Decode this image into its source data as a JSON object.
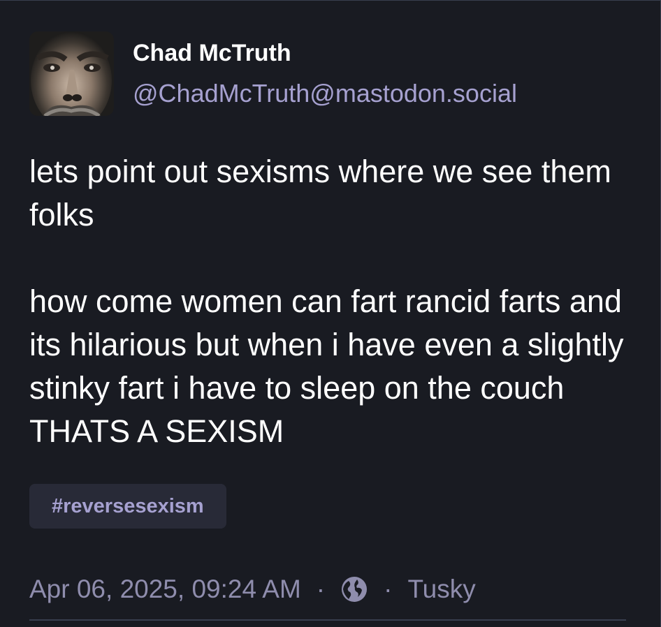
{
  "author": {
    "display_name": "Chad McTruth",
    "handle": "@ChadMcTruth@mastodon.social",
    "avatar_icon": "avatar-photo"
  },
  "post": {
    "paragraphs": [
      "lets point out sexisms where we see them folks",
      "how come women can fart rancid farts and its hilarious but when i have even a slightly stinky fart i have to sleep on the couch THATS A SEXISM"
    ],
    "hashtag": "#reversesexism"
  },
  "meta": {
    "timestamp": "Apr 06, 2025, 09:24 AM",
    "separator": "·",
    "visibility_icon": "globe-icon",
    "application": "Tusky"
  },
  "colors": {
    "background": "#191b22",
    "text": "#ffffff",
    "accent": "#a6a1d0",
    "muted": "#8f8dad",
    "tag_bg": "#282a37"
  }
}
